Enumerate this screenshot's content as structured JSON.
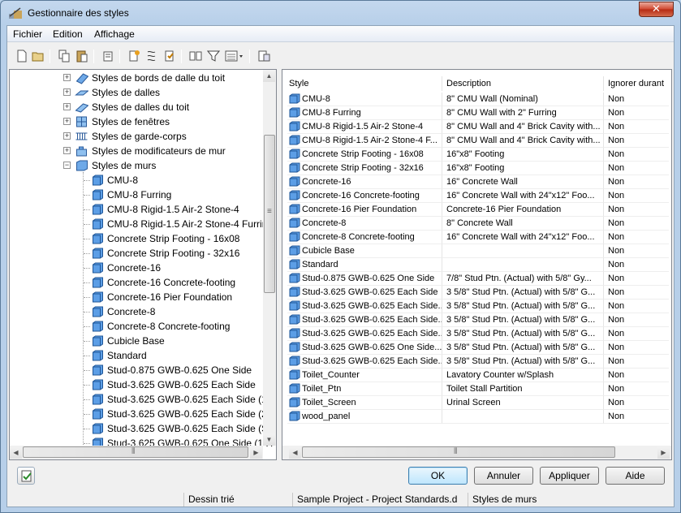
{
  "window": {
    "title": "Gestionnaire des styles",
    "close_glyph": "✕"
  },
  "menu": [
    {
      "label": "Fichier"
    },
    {
      "label": "Edition"
    },
    {
      "label": "Affichage"
    }
  ],
  "tree": {
    "categories": [
      {
        "label": "Styles de bords de dalle du toit",
        "icon": "roof-slab-edge-icon"
      },
      {
        "label": "Styles de dalles",
        "icon": "slab-icon"
      },
      {
        "label": "Styles de dalles du toit",
        "icon": "roof-slab-icon"
      },
      {
        "label": "Styles de fenêtres",
        "icon": "window-icon"
      },
      {
        "label": "Styles de garde-corps",
        "icon": "railing-icon"
      },
      {
        "label": "Styles de modificateurs de mur",
        "icon": "wall-modifier-icon"
      },
      {
        "label": "Styles de murs",
        "icon": "wall-icon",
        "expanded": true
      }
    ],
    "children": [
      "CMU-8",
      "CMU-8 Furring",
      "CMU-8 Rigid-1.5 Air-2 Stone-4",
      "CMU-8 Rigid-1.5 Air-2 Stone-4 Furrir",
      "Concrete Strip Footing - 16x08",
      "Concrete Strip Footing - 32x16",
      "Concrete-16",
      "Concrete-16 Concrete-footing",
      "Concrete-16 Pier Foundation",
      "Concrete-8",
      "Concrete-8 Concrete-footing",
      "Cubicle Base",
      "Standard",
      "Stud-0.875 GWB-0.625 One Side",
      "Stud-3.625 GWB-0.625 Each Side",
      "Stud-3.625 GWB-0.625 Each Side (1 H",
      "Stud-3.625 GWB-0.625 Each Side (2 H",
      "Stud-3.625 GWB-0.625 Each Side (So",
      "Stud-3.625 GWB-0.625 One Side (1 H"
    ]
  },
  "list": {
    "columns": [
      "Style",
      "Description",
      "Ignorer durant"
    ],
    "rows": [
      [
        "CMU-8",
        "8\" CMU Wall (Nominal)",
        "Non"
      ],
      [
        "CMU-8 Furring",
        "8\" CMU Wall with 2\" Furring",
        "Non"
      ],
      [
        "CMU-8 Rigid-1.5 Air-2 Stone-4",
        "8\" CMU Wall and 4\" Brick Cavity with...",
        "Non"
      ],
      [
        "CMU-8 Rigid-1.5 Air-2 Stone-4 F...",
        "8\" CMU Wall and 4\" Brick Cavity with...",
        "Non"
      ],
      [
        "Concrete Strip Footing - 16x08",
        "16\"x8\" Footing",
        "Non"
      ],
      [
        "Concrete Strip Footing - 32x16",
        "16\"x8\" Footing",
        "Non"
      ],
      [
        "Concrete-16",
        "16\" Concrete Wall",
        "Non"
      ],
      [
        "Concrete-16 Concrete-footing",
        "16\" Concrete Wall with 24\"x12\" Foo...",
        "Non"
      ],
      [
        "Concrete-16 Pier Foundation",
        "Concrete-16 Pier Foundation",
        "Non"
      ],
      [
        "Concrete-8",
        "8\" Concrete Wall",
        "Non"
      ],
      [
        "Concrete-8 Concrete-footing",
        "16\" Concrete Wall with 24\"x12\" Foo...",
        "Non"
      ],
      [
        "Cubicle Base",
        "",
        "Non"
      ],
      [
        "Standard",
        "",
        "Non"
      ],
      [
        "Stud-0.875 GWB-0.625 One Side",
        "7/8\" Stud Ptn. (Actual) with 5/8\" Gy...",
        "Non"
      ],
      [
        "Stud-3.625 GWB-0.625 Each Side",
        "3 5/8\" Stud Ptn. (Actual) with 5/8\" G...",
        "Non"
      ],
      [
        "Stud-3.625 GWB-0.625 Each Side...",
        "3 5/8\" Stud Ptn. (Actual) with 5/8\" G...",
        "Non"
      ],
      [
        "Stud-3.625 GWB-0.625 Each Side...",
        "3 5/8\" Stud Ptn. (Actual) with 5/8\" G...",
        "Non"
      ],
      [
        "Stud-3.625 GWB-0.625 Each Side...",
        "3 5/8\" Stud Ptn. (Actual) with 5/8\" G...",
        "Non"
      ],
      [
        "Stud-3.625 GWB-0.625 One Side...",
        "3 5/8\" Stud Ptn. (Actual) with 5/8\" G...",
        "Non"
      ],
      [
        "Stud-3.625 GWB-0.625 Each Side...",
        "3 5/8\" Stud Ptn. (Actual) with 5/8\" G...",
        "Non"
      ],
      [
        "Toilet_Counter",
        "Lavatory Counter w/Splash",
        "Non"
      ],
      [
        "Toilet_Ptn",
        "Toilet Stall Partition",
        "Non"
      ],
      [
        "Toilet_Screen",
        "Urinal Screen",
        "Non"
      ],
      [
        "wood_panel",
        "",
        "Non"
      ]
    ]
  },
  "buttons": {
    "ok": "OK",
    "cancel": "Annuler",
    "apply": "Appliquer",
    "help": "Aide"
  },
  "status": {
    "cell1": "Dessin trié",
    "cell2": "Sample Project - Project Standards.d",
    "cell3": "Styles de murs"
  },
  "scroll_glyphs": {
    "up": "▲",
    "down": "▼",
    "left": "◀",
    "right": "▶",
    "grip": "≡",
    "grip_h": "⦀"
  },
  "tree_expander": {
    "collapsed": "+",
    "expanded": "−"
  },
  "colors": {
    "folder": "#4f8fd8",
    "accent": "#3c7fb1"
  }
}
